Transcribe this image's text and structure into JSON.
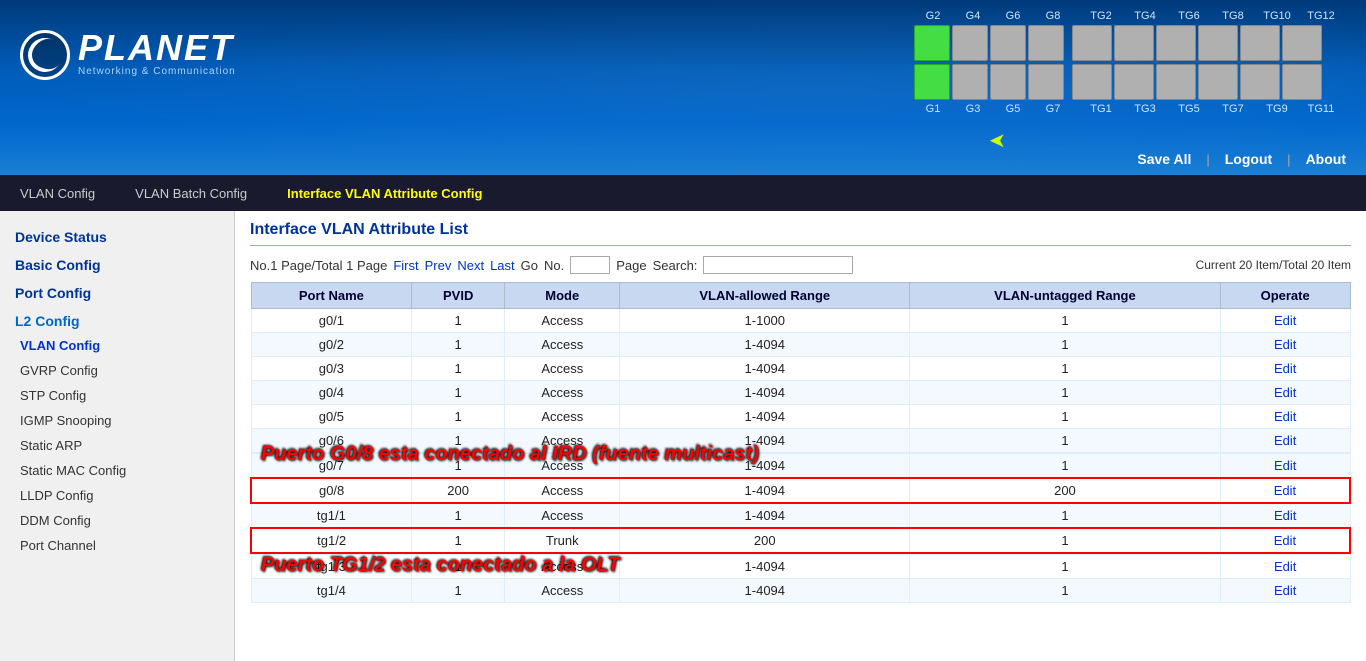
{
  "header": {
    "logo_text": "PLANET",
    "logo_sub": "Networking & Communication",
    "save_all": "Save All",
    "logout": "Logout",
    "about": "About"
  },
  "port_display": {
    "top_labels": [
      "G2",
      "G4",
      "G6",
      "G8",
      "TG2",
      "TG4",
      "TG6",
      "TG8",
      "TG10",
      "TG12"
    ],
    "bottom_labels": [
      "G1",
      "G3",
      "G5",
      "G7",
      "TG1",
      "TG3",
      "TG5",
      "TG7",
      "TG9",
      "TG11"
    ],
    "active_ports_top": [
      0
    ],
    "active_ports_bottom": [
      0
    ]
  },
  "nav": {
    "items": [
      {
        "label": "VLAN Config",
        "active": false
      },
      {
        "label": "VLAN Batch Config",
        "active": false
      },
      {
        "label": "Interface VLAN Attribute Config",
        "active": true
      }
    ]
  },
  "sidebar": {
    "sections": [
      {
        "label": "Device Status",
        "type": "section"
      },
      {
        "label": "Basic Config",
        "type": "section"
      },
      {
        "label": "Port Config",
        "type": "section"
      },
      {
        "label": "L2 Config",
        "type": "section-active"
      },
      {
        "label": "VLAN Config",
        "type": "subsection-active"
      },
      {
        "label": "GVRP Config",
        "type": "item"
      },
      {
        "label": "STP Config",
        "type": "item"
      },
      {
        "label": "IGMP Snooping",
        "type": "item"
      },
      {
        "label": "Static ARP",
        "type": "item"
      },
      {
        "label": "Static MAC Config",
        "type": "item"
      },
      {
        "label": "LLDP Config",
        "type": "item"
      },
      {
        "label": "DDM Config",
        "type": "item"
      },
      {
        "label": "Port Channel",
        "type": "item"
      }
    ]
  },
  "content": {
    "title": "Interface VLAN Attribute List",
    "pagination": {
      "info": "No.1 Page/Total 1 Page",
      "first": "First",
      "prev": "Prev",
      "next": "Next",
      "last": "Last",
      "go": "Go",
      "no_label": "No.",
      "page_label": "Page",
      "search_label": "Search:",
      "current_info": "Current 20 Item/Total 20 Item"
    },
    "table_headers": [
      "Port Name",
      "PVID",
      "Mode",
      "VLAN-allowed Range",
      "VLAN-untagged Range",
      "Operate"
    ],
    "rows": [
      {
        "port": "g0/1",
        "pvid": "1",
        "mode": "Access",
        "vlan_allowed": "1-1000",
        "vlan_untagged": "1",
        "operate": "Edit",
        "highlighted": false
      },
      {
        "port": "g0/2",
        "pvid": "1",
        "mode": "Access",
        "vlan_allowed": "1-4094",
        "vlan_untagged": "1",
        "operate": "Edit",
        "highlighted": false
      },
      {
        "port": "g0/3",
        "pvid": "1",
        "mode": "Access",
        "vlan_allowed": "1-4094",
        "vlan_untagged": "1",
        "operate": "Edit",
        "highlighted": false
      },
      {
        "port": "g0/4",
        "pvid": "1",
        "mode": "Access",
        "vlan_allowed": "1-4094",
        "vlan_untagged": "1",
        "operate": "Edit",
        "highlighted": false
      },
      {
        "port": "g0/5",
        "pvid": "1",
        "mode": "Access",
        "vlan_allowed": "1-4094",
        "vlan_untagged": "1",
        "operate": "Edit",
        "highlighted": false
      },
      {
        "port": "g0/6",
        "pvid": "1",
        "mode": "Access",
        "vlan_allowed": "1-4094",
        "vlan_untagged": "1",
        "operate": "Edit",
        "highlighted": false
      },
      {
        "port": "g0/7",
        "pvid": "1",
        "mode": "Access",
        "vlan_allowed": "1-4094",
        "vlan_untagged": "1",
        "operate": "Edit",
        "annotation": "Puerto G0/8 esta conectado al IRD (fuente multicast)",
        "highlighted": false
      },
      {
        "port": "g0/8",
        "pvid": "200",
        "mode": "Access",
        "vlan_allowed": "1-4094",
        "vlan_untagged": "200",
        "operate": "Edit",
        "highlighted": true
      },
      {
        "port": "tg1/1",
        "pvid": "1",
        "mode": "Access",
        "vlan_allowed": "1-4094",
        "vlan_untagged": "1",
        "operate": "Edit",
        "highlighted": false
      },
      {
        "port": "tg1/2",
        "pvid": "1",
        "mode": "Trunk",
        "vlan_allowed": "200",
        "vlan_untagged": "1",
        "operate": "Edit",
        "highlighted": true,
        "annotation2": "Puerto TG1/2 esta conectado a la OLT"
      },
      {
        "port": "tg1/3",
        "pvid": "1",
        "mode": "Access",
        "vlan_allowed": "1-4094",
        "vlan_untagged": "1",
        "operate": "Edit",
        "highlighted": false
      },
      {
        "port": "tg1/4",
        "pvid": "1",
        "mode": "Access",
        "vlan_allowed": "1-4094",
        "vlan_untagged": "1",
        "operate": "Edit",
        "highlighted": false
      }
    ],
    "annotation1": "Puerto G0/8 esta conectado al IRD (fuente multicast)",
    "annotation2": "Puerto TG1/2 esta conectado a la OLT"
  }
}
